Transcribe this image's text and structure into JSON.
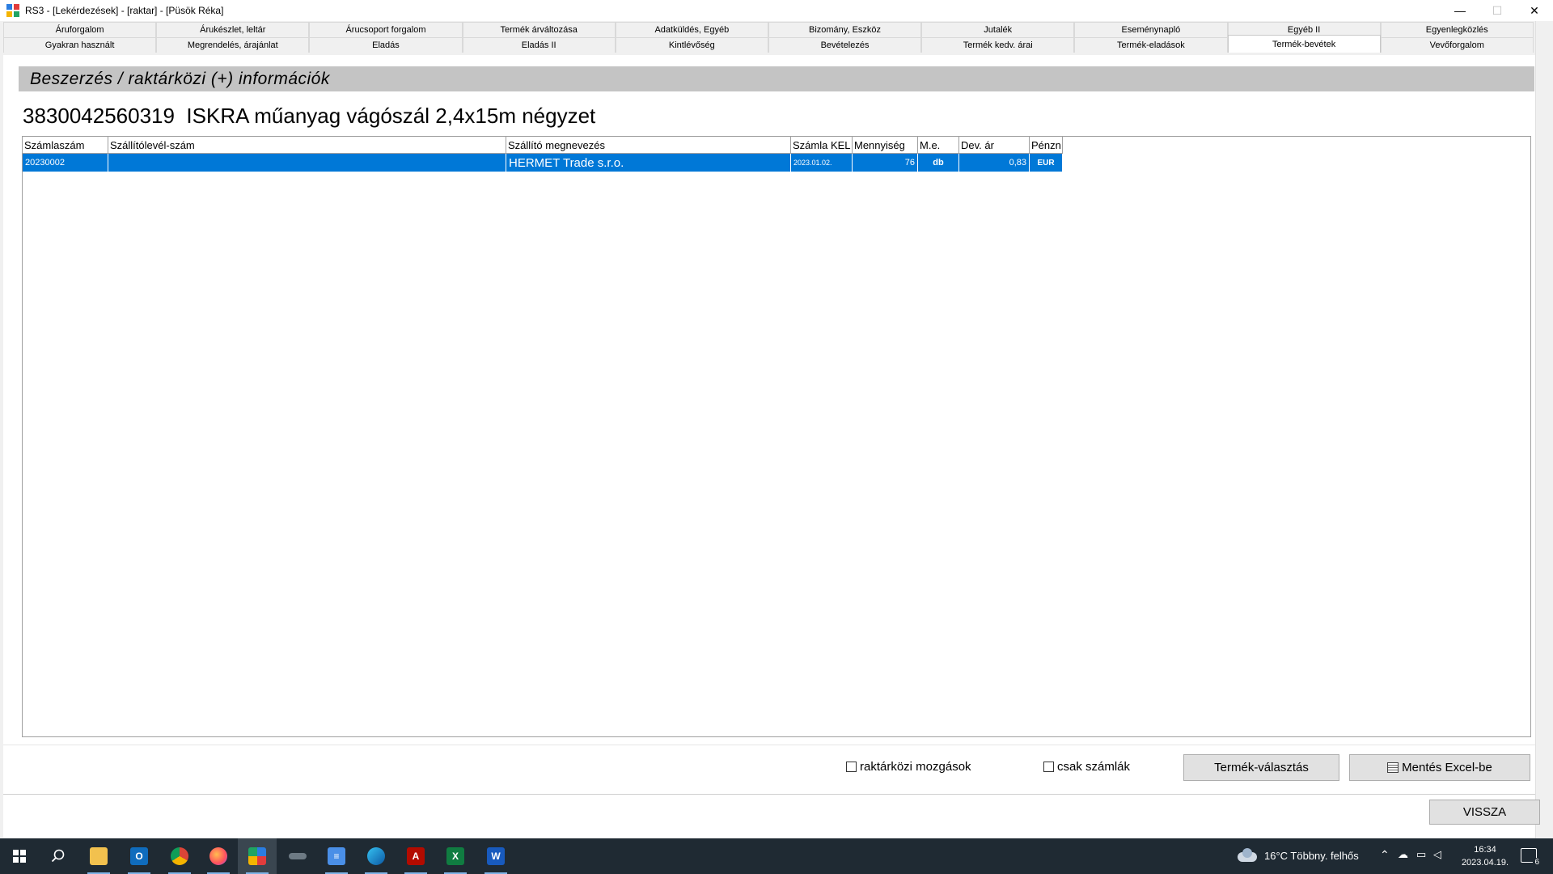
{
  "window": {
    "title": "RS3 - [Lekérdezések] - [raktar] - [Püsök Réka]",
    "controls": {
      "minimize": "—",
      "maximize": "☐",
      "close": "✕"
    }
  },
  "tabs": {
    "row1": [
      "Áruforgalom",
      "Árukészlet, leltár",
      "Árucsoport forgalom",
      "Termék árváltozása",
      "Adatküldés, Egyéb",
      "Bizomány, Eszköz",
      "Jutalék",
      "Eseménynapló",
      "Egyéb II",
      "Egyenlegközlés"
    ],
    "row2": [
      "Gyakran használt",
      "Megrendelés, árajánlat",
      "Eladás",
      "Eladás II",
      "Kintlévőség",
      "Bevételezés",
      "Termék kedv. árai",
      "Termék-eladások",
      "Termék-bevétek",
      "Vevőforgalom"
    ],
    "active": "Termék-bevétek"
  },
  "section": {
    "header": "Beszerzés / raktárközi (+) információk"
  },
  "product": {
    "title": "3830042560319  ISKRA műanyag vágószál 2,4x15m négyzet"
  },
  "grid": {
    "columns": [
      "Számlaszám",
      "Szállítólevél-szám",
      "Szállító megnevezés",
      "Számla KEL",
      "Mennyiség",
      "M.e.",
      "Dev. ár",
      "Pénzn"
    ],
    "rows": [
      {
        "invoice": "20230002",
        "delivery_note": "",
        "supplier": "HERMET Trade s.r.o.",
        "invoice_date": "2023.01.02.",
        "quantity": "76",
        "unit": "db",
        "price": "0,83",
        "currency": "EUR"
      }
    ]
  },
  "options": {
    "warehouse_moves": {
      "label": "raktárközi mozgások",
      "checked": false
    },
    "invoices_only": {
      "label": "csak számlák",
      "checked": false
    }
  },
  "buttons": {
    "product_select": "Termék-választás",
    "save_excel": "Mentés Excel-be",
    "back": "VISSZA"
  },
  "taskbar": {
    "icons": [
      "windows-start-icon",
      "search-icon",
      "file-explorer-icon",
      "outlook-icon",
      "chrome-icon",
      "firefox-icon",
      "rs3-app-icon",
      "app-icon",
      "notepad-icon",
      "edge-icon",
      "acrobat-icon",
      "excel-icon",
      "word-icon"
    ],
    "weather": "16°C  Többny. felhős",
    "time": "16:34",
    "date": "2023.04.19.",
    "notifications": "6"
  },
  "colors": {
    "selection": "#0078d7",
    "header_bar": "#c4c4c4",
    "taskbar": "#1f2a33"
  }
}
